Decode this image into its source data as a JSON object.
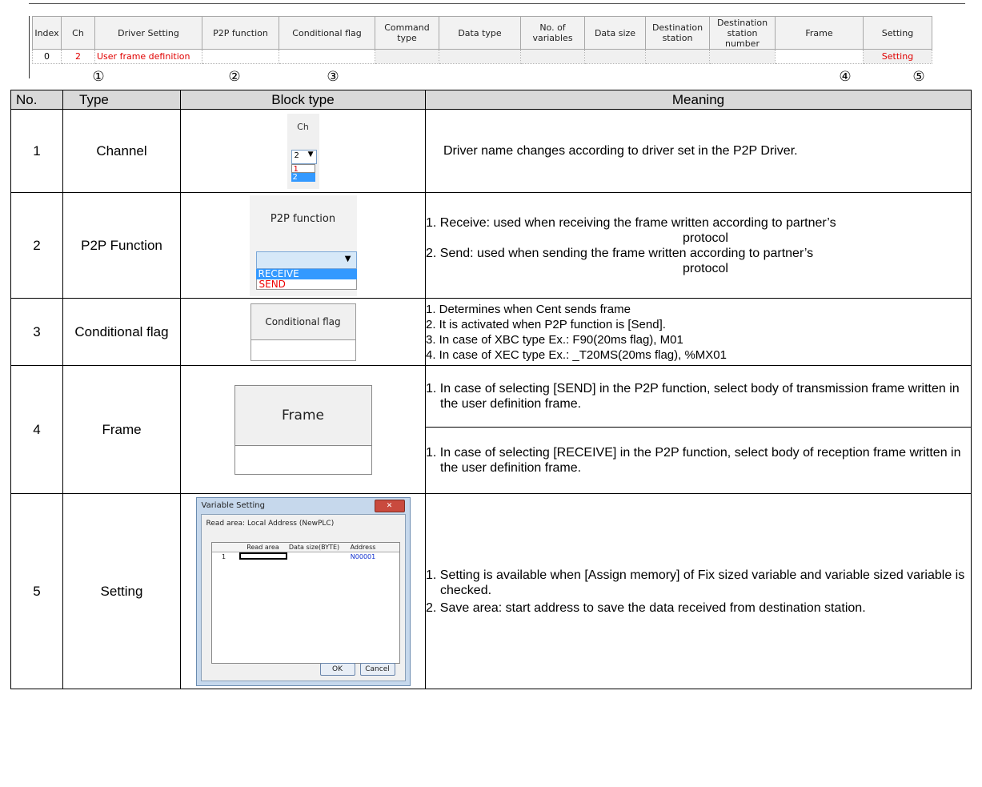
{
  "grid": {
    "headers": [
      "Index",
      "Ch",
      "Driver Setting",
      "P2P function",
      "Conditional flag",
      "Command type",
      "Data type",
      "No. of variables",
      "Data size",
      "Destination station",
      "Destination station number",
      "Frame",
      "Setting"
    ],
    "row": {
      "index": "0",
      "ch": "2",
      "driver_setting": "User frame definition",
      "setting": "Setting"
    },
    "markers": [
      "①",
      "②",
      "③",
      "④",
      "⑤"
    ]
  },
  "table": {
    "headers": {
      "no": "No.",
      "type": "Type",
      "block_type": "Block type",
      "meaning": "Meaning"
    },
    "rows": [
      {
        "no": "1",
        "type": "Channel",
        "block": {
          "header": "Ch",
          "value": "2",
          "options": [
            "1",
            "2"
          ]
        },
        "meaning": "Driver name changes according to driver set in the P2P Driver."
      },
      {
        "no": "2",
        "type": "P2P Function",
        "block": {
          "header": "P2P function",
          "options": [
            "RECEIVE",
            "SEND"
          ]
        },
        "meaning": [
          {
            "first": "1. Receive: used when receiving the frame written according to partner’s",
            "cont": "protocol"
          },
          {
            "first": "2. Send: used when sending the frame written according to partner’s",
            "cont": "protocol"
          }
        ]
      },
      {
        "no": "3",
        "type": "Conditional flag",
        "block": {
          "header": "Conditional flag"
        },
        "meaning": [
          "1. Determines when Cent sends frame",
          "2. It is activated when P2P function is [Send].",
          "3. In case of XBC type Ex.: F90(20ms flag), M01",
          "4. In case of XEC type Ex.: _T20MS(20ms flag), %MX01"
        ]
      },
      {
        "no": "4",
        "type": "Frame",
        "block": {
          "header": "Frame"
        },
        "meaning_send": "1. In case of selecting [SEND] in the P2P function, select body of transmission frame written in the user definition frame.",
        "meaning_receive": "1. In case of selecting [RECEIVE] in the P2P function, select body of reception frame written in the user definition frame."
      },
      {
        "no": "5",
        "type": "Setting",
        "block": {
          "title": "Variable Setting",
          "caption": "Read area: Local Address (NewPLC)",
          "columns": [
            "Read area",
            "Data size(BYTE)",
            "Address"
          ],
          "row_no": "1",
          "address": "N00001",
          "ok": "OK",
          "cancel": "Cancel"
        },
        "meaning": [
          "1. Setting is available when [Assign memory] of Fix sized variable and variable sized variable is checked.",
          "2. Save area: start address to save the data received from destination station."
        ]
      }
    ]
  }
}
